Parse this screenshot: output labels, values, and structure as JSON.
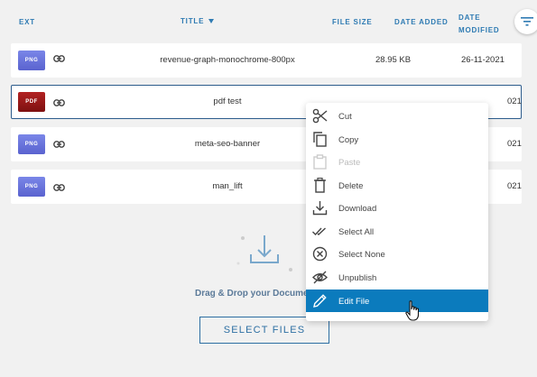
{
  "header": {
    "ext": "EXT",
    "title": "TITLE",
    "file_size": "FILE SIZE",
    "date_added": "DATE ADDED",
    "date_modified_1": "DATE",
    "date_modified_2": "MODIFIED"
  },
  "rows": [
    {
      "ext": "PNG",
      "name": "revenue-graph-monochrome-800px",
      "size": "28.95 KB",
      "date": "26-11-2021"
    },
    {
      "ext": "PDF",
      "name": "pdf test",
      "size": "",
      "date": "021"
    },
    {
      "ext": "PNG",
      "name": "meta-seo-banner",
      "size": "",
      "date": "021"
    },
    {
      "ext": "PNG",
      "name": "man_lift",
      "size": "",
      "date": "021"
    }
  ],
  "dropzone": {
    "text": "Drag & Drop your Docume",
    "button": "SELECT FILES"
  },
  "menu": {
    "items": [
      {
        "label": "Cut",
        "icon": "scissors-icon"
      },
      {
        "label": "Copy",
        "icon": "copy-icon"
      },
      {
        "label": "Paste",
        "icon": "paste-icon",
        "disabled": true
      },
      {
        "label": "Delete",
        "icon": "trash-icon"
      },
      {
        "label": "Download",
        "icon": "download-icon"
      },
      {
        "label": "Select All",
        "icon": "double-check-icon"
      },
      {
        "label": "Select None",
        "icon": "circle-x-icon"
      },
      {
        "label": "Unpublish",
        "icon": "eye-off-icon"
      },
      {
        "label": "Edit File",
        "icon": "pencil-icon",
        "active": true
      }
    ]
  },
  "colors": {
    "accent": "#0b7bbd",
    "header_text": "#2f7bb3",
    "png_badge": "#6670db",
    "pdf_badge": "#9b1a1a"
  }
}
